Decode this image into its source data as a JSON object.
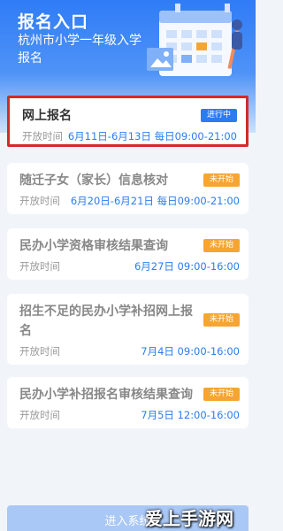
{
  "header": {
    "title": "报名入口",
    "subtitle": "杭州市小学一年级入学报名"
  },
  "cards": [
    {
      "title": "网上报名",
      "status": "进行中",
      "label": "开放时间",
      "value": "6月11日-6月13日 每日09:00-21:00"
    },
    {
      "title": "随迁子女（家长）信息核对",
      "status": "未开始",
      "label": "开放时间",
      "value": "6月20日-6月21日 每日09:00-21:00"
    },
    {
      "title": "民办小学资格审核结果查询",
      "status": "未开始",
      "label": "开放时间",
      "value": "6月27日 09:00-16:00"
    },
    {
      "title": "招生不足的民办小学补招网上报名",
      "status": "未开始",
      "label": "开放时间",
      "value": "7月4日 09:00-16:00"
    },
    {
      "title": "民办小学补招报名审核结果查询",
      "status": "未开始",
      "label": "开放时间",
      "value": "7月5日 12:00-16:00"
    }
  ],
  "bottom_button": "进入系统",
  "watermark": "爱上手游网",
  "colors": {
    "accent": "#2b7bf3",
    "pending": "#f7a532",
    "highlight": "#d42a2a"
  }
}
